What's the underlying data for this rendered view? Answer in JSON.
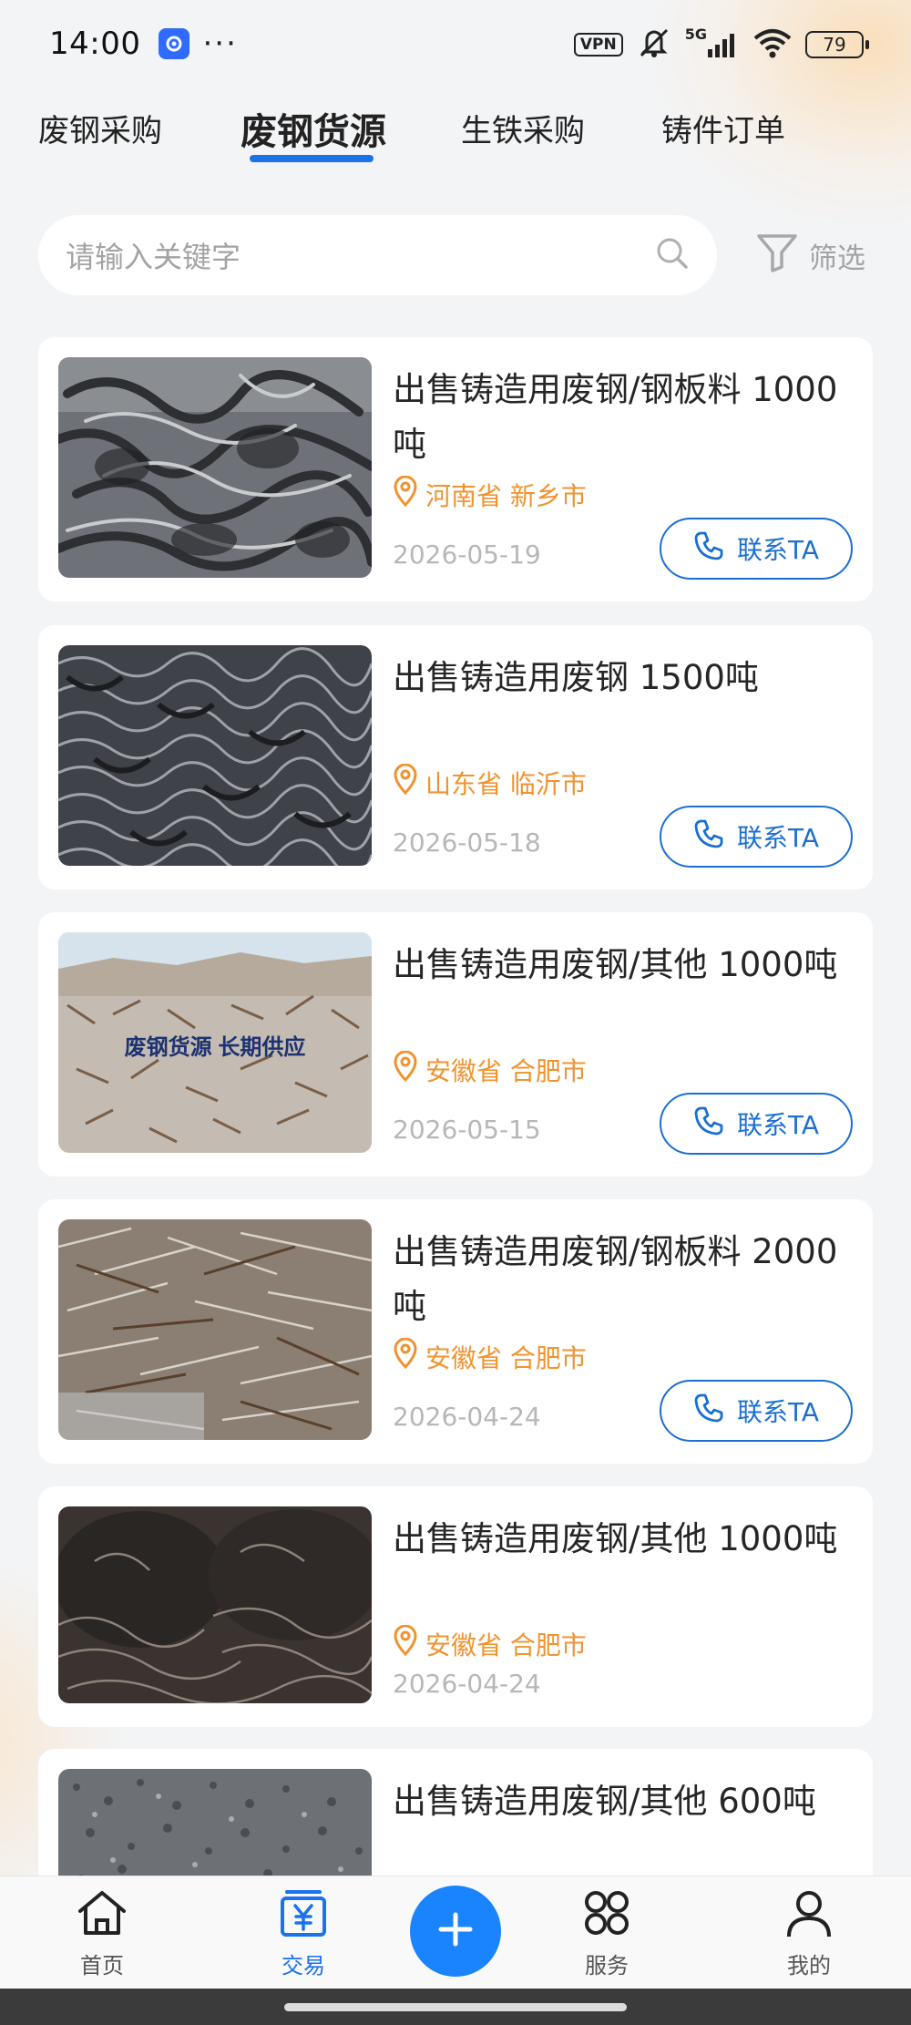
{
  "status_bar": {
    "time": "14:00",
    "more": "···",
    "vpn_label": "VPN",
    "network": "5G",
    "battery_level": "79"
  },
  "tabs": [
    {
      "label": "废钢采购",
      "active": false
    },
    {
      "label": "废钢货源",
      "active": true
    },
    {
      "label": "生铁采购",
      "active": false
    },
    {
      "label": "铸件订单",
      "active": false
    }
  ],
  "search": {
    "placeholder": "请输入关键字",
    "filter_label": "筛选"
  },
  "listings": [
    {
      "title": "出售铸造用废钢/钢板料 1000吨",
      "location": "河南省 新乡市",
      "date": "2026-05-19",
      "contact_label": "联系TA",
      "show_contact": true
    },
    {
      "title": "出售铸造用废钢 1500吨",
      "location": "山东省 临沂市",
      "date": "2026-05-18",
      "contact_label": "联系TA",
      "show_contact": true
    },
    {
      "title": "出售铸造用废钢/其他 1000吨",
      "location": "安徽省 合肥市",
      "date": "2026-05-15",
      "contact_label": "联系TA",
      "show_contact": true,
      "image_caption": "废钢货源   长期供应"
    },
    {
      "title": "出售铸造用废钢/钢板料 2000吨",
      "location": "安徽省 合肥市",
      "date": "2026-04-24",
      "contact_label": "联系TA",
      "show_contact": true
    },
    {
      "title": "出售铸造用废钢/其他 1000吨",
      "location": "安徽省 合肥市",
      "date": "2026-04-24",
      "contact_label": "联系TA",
      "show_contact": false
    },
    {
      "title": "出售铸造用废钢/其他 600吨",
      "location": "",
      "date": "",
      "contact_label": "",
      "show_contact": false
    }
  ],
  "bottom_nav": [
    {
      "label": "首页",
      "icon": "home-icon",
      "active": false
    },
    {
      "label": "交易",
      "icon": "trade-icon",
      "active": true
    },
    {
      "label": "",
      "icon": "plus-icon",
      "active": false
    },
    {
      "label": "服务",
      "icon": "service-icon",
      "active": false
    },
    {
      "label": "我的",
      "icon": "user-icon",
      "active": false
    }
  ],
  "colors": {
    "accent": "#1a73e8",
    "location": "#f0932e",
    "contact": "#1a6fd1",
    "fab": "#1a84ff"
  }
}
